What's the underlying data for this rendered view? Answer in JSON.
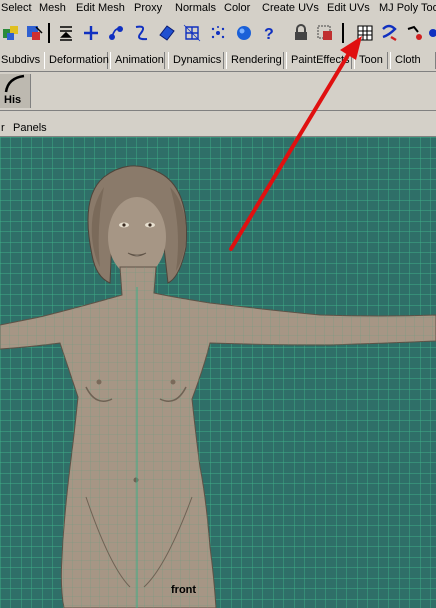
{
  "menubar": {
    "items": [
      "Select",
      "Mesh",
      "Edit Mesh",
      "Proxy",
      "Normals",
      "Color",
      "Create UVs",
      "Edit UVs",
      "MJ Poly Too"
    ]
  },
  "toolbar": {
    "icons": [
      "select-by-component-icon",
      "paint-select-icon",
      "collapse-icon",
      "plus-icon",
      "soft-mod-icon",
      "curve-tool-icon",
      "surface-icon",
      "lattice-icon",
      "particle-icon",
      "sphere-icon",
      "help-icon",
      "lock-icon",
      "component-select-icon",
      "uv-texture-editor-icon",
      "magnet-icon",
      "snap-icon"
    ]
  },
  "tabs": {
    "items": [
      "Subdivs",
      "Deformation",
      "Animation",
      "Dynamics",
      "Rendering",
      "PaintEffects",
      "Toon",
      "Cloth"
    ]
  },
  "shelf": {
    "history_label": "His"
  },
  "panel_menu": {
    "items": [
      "r",
      "Panels"
    ]
  },
  "viewport": {
    "camera_label": "front",
    "grid_color": "#3fae88",
    "background": "#2f6f68",
    "model_color": "#a69685"
  },
  "annotation": {
    "arrow_color": "#e01010"
  }
}
